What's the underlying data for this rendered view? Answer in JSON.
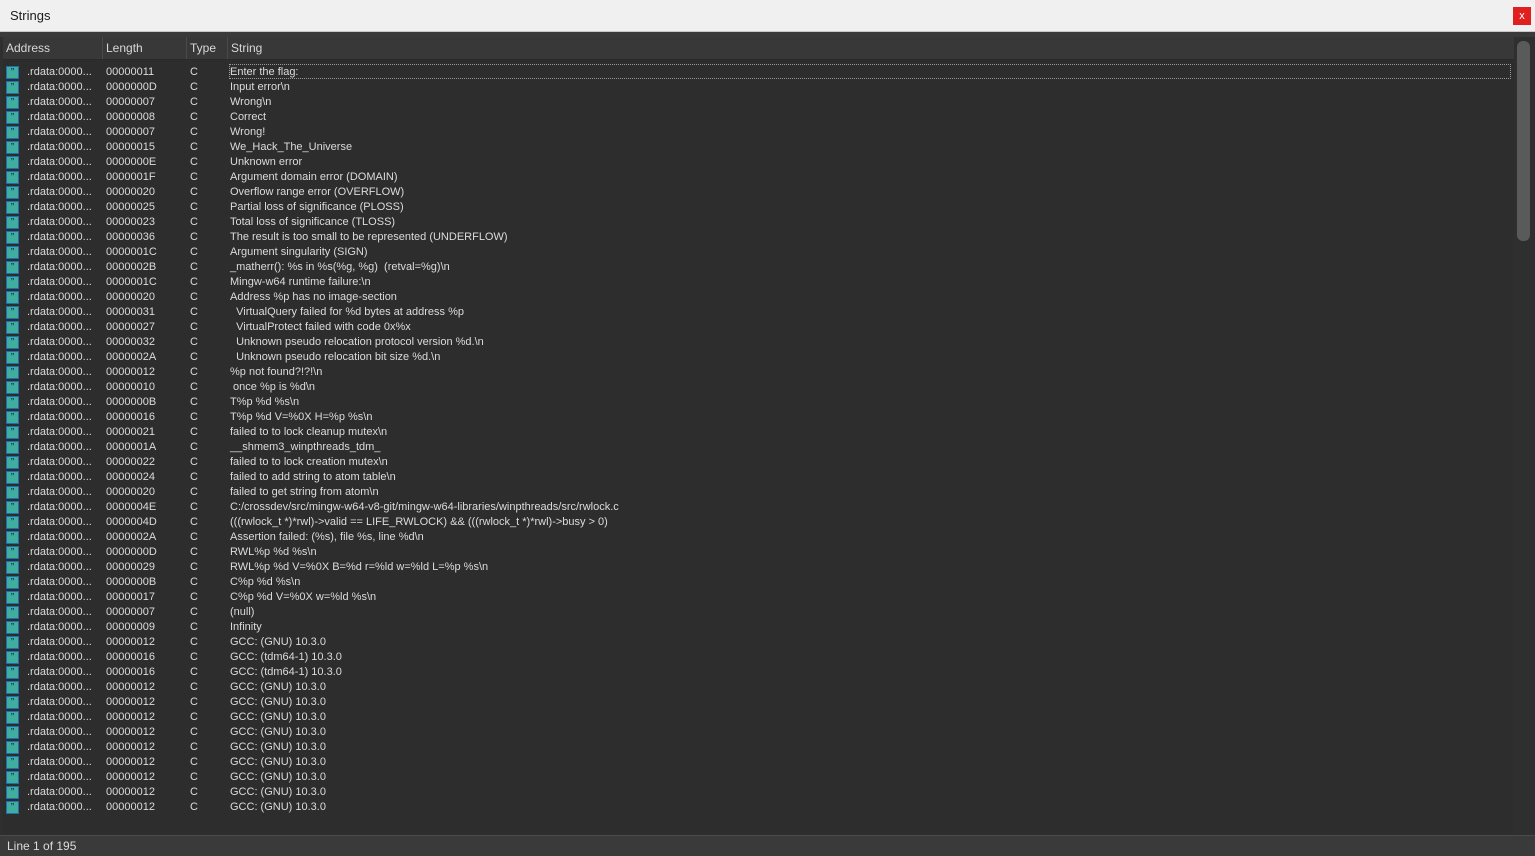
{
  "window": {
    "title": "Strings",
    "close_label": "x"
  },
  "columns": [
    "Address",
    "Length",
    "Type",
    "String"
  ],
  "rows": [
    {
      "address": ".rdata:0000...",
      "length": "00000011",
      "type": "C",
      "string": "Enter the flag:"
    },
    {
      "address": ".rdata:0000...",
      "length": "0000000D",
      "type": "C",
      "string": "Input error\\n"
    },
    {
      "address": ".rdata:0000...",
      "length": "00000007",
      "type": "C",
      "string": "Wrong\\n"
    },
    {
      "address": ".rdata:0000...",
      "length": "00000008",
      "type": "C",
      "string": "Correct"
    },
    {
      "address": ".rdata:0000...",
      "length": "00000007",
      "type": "C",
      "string": "Wrong!"
    },
    {
      "address": ".rdata:0000...",
      "length": "00000015",
      "type": "C",
      "string": "We_Hack_The_Universe"
    },
    {
      "address": ".rdata:0000...",
      "length": "0000000E",
      "type": "C",
      "string": "Unknown error"
    },
    {
      "address": ".rdata:0000...",
      "length": "0000001F",
      "type": "C",
      "string": "Argument domain error (DOMAIN)"
    },
    {
      "address": ".rdata:0000...",
      "length": "00000020",
      "type": "C",
      "string": "Overflow range error (OVERFLOW)"
    },
    {
      "address": ".rdata:0000...",
      "length": "00000025",
      "type": "C",
      "string": "Partial loss of significance (PLOSS)"
    },
    {
      "address": ".rdata:0000...",
      "length": "00000023",
      "type": "C",
      "string": "Total loss of significance (TLOSS)"
    },
    {
      "address": ".rdata:0000...",
      "length": "00000036",
      "type": "C",
      "string": "The result is too small to be represented (UNDERFLOW)"
    },
    {
      "address": ".rdata:0000...",
      "length": "0000001C",
      "type": "C",
      "string": "Argument singularity (SIGN)"
    },
    {
      "address": ".rdata:0000...",
      "length": "0000002B",
      "type": "C",
      "string": "_matherr(): %s in %s(%g, %g)  (retval=%g)\\n"
    },
    {
      "address": ".rdata:0000...",
      "length": "0000001C",
      "type": "C",
      "string": "Mingw-w64 runtime failure:\\n"
    },
    {
      "address": ".rdata:0000...",
      "length": "00000020",
      "type": "C",
      "string": "Address %p has no image-section"
    },
    {
      "address": ".rdata:0000...",
      "length": "00000031",
      "type": "C",
      "string": "  VirtualQuery failed for %d bytes at address %p"
    },
    {
      "address": ".rdata:0000...",
      "length": "00000027",
      "type": "C",
      "string": "  VirtualProtect failed with code 0x%x"
    },
    {
      "address": ".rdata:0000...",
      "length": "00000032",
      "type": "C",
      "string": "  Unknown pseudo relocation protocol version %d.\\n"
    },
    {
      "address": ".rdata:0000...",
      "length": "0000002A",
      "type": "C",
      "string": "  Unknown pseudo relocation bit size %d.\\n"
    },
    {
      "address": ".rdata:0000...",
      "length": "00000012",
      "type": "C",
      "string": "%p not found?!?!\\n"
    },
    {
      "address": ".rdata:0000...",
      "length": "00000010",
      "type": "C",
      "string": " once %p is %d\\n"
    },
    {
      "address": ".rdata:0000...",
      "length": "0000000B",
      "type": "C",
      "string": "T%p %d %s\\n"
    },
    {
      "address": ".rdata:0000...",
      "length": "00000016",
      "type": "C",
      "string": "T%p %d V=%0X H=%p %s\\n"
    },
    {
      "address": ".rdata:0000...",
      "length": "00000021",
      "type": "C",
      "string": "failed to to lock cleanup mutex\\n"
    },
    {
      "address": ".rdata:0000...",
      "length": "0000001A",
      "type": "C",
      "string": "__shmem3_winpthreads_tdm_"
    },
    {
      "address": ".rdata:0000...",
      "length": "00000022",
      "type": "C",
      "string": "failed to to lock creation mutex\\n"
    },
    {
      "address": ".rdata:0000...",
      "length": "00000024",
      "type": "C",
      "string": "failed to add string to atom table\\n"
    },
    {
      "address": ".rdata:0000...",
      "length": "00000020",
      "type": "C",
      "string": "failed to get string from atom\\n"
    },
    {
      "address": ".rdata:0000...",
      "length": "0000004E",
      "type": "C",
      "string": "C:/crossdev/src/mingw-w64-v8-git/mingw-w64-libraries/winpthreads/src/rwlock.c"
    },
    {
      "address": ".rdata:0000...",
      "length": "0000004D",
      "type": "C",
      "string": "(((rwlock_t *)*rwl)->valid == LIFE_RWLOCK) && (((rwlock_t *)*rwl)->busy > 0)"
    },
    {
      "address": ".rdata:0000...",
      "length": "0000002A",
      "type": "C",
      "string": "Assertion failed: (%s), file %s, line %d\\n"
    },
    {
      "address": ".rdata:0000...",
      "length": "0000000D",
      "type": "C",
      "string": "RWL%p %d %s\\n"
    },
    {
      "address": ".rdata:0000...",
      "length": "00000029",
      "type": "C",
      "string": "RWL%p %d V=%0X B=%d r=%ld w=%ld L=%p %s\\n"
    },
    {
      "address": ".rdata:0000...",
      "length": "0000000B",
      "type": "C",
      "string": "C%p %d %s\\n"
    },
    {
      "address": ".rdata:0000...",
      "length": "00000017",
      "type": "C",
      "string": "C%p %d V=%0X w=%ld %s\\n"
    },
    {
      "address": ".rdata:0000...",
      "length": "00000007",
      "type": "C",
      "string": "(null)"
    },
    {
      "address": ".rdata:0000...",
      "length": "00000009",
      "type": "C",
      "string": "Infinity"
    },
    {
      "address": ".rdata:0000...",
      "length": "00000012",
      "type": "C",
      "string": "GCC: (GNU) 10.3.0"
    },
    {
      "address": ".rdata:0000...",
      "length": "00000016",
      "type": "C",
      "string": "GCC: (tdm64-1) 10.3.0"
    },
    {
      "address": ".rdata:0000...",
      "length": "00000016",
      "type": "C",
      "string": "GCC: (tdm64-1) 10.3.0"
    },
    {
      "address": ".rdata:0000...",
      "length": "00000012",
      "type": "C",
      "string": "GCC: (GNU) 10.3.0"
    },
    {
      "address": ".rdata:0000...",
      "length": "00000012",
      "type": "C",
      "string": "GCC: (GNU) 10.3.0"
    },
    {
      "address": ".rdata:0000...",
      "length": "00000012",
      "type": "C",
      "string": "GCC: (GNU) 10.3.0"
    },
    {
      "address": ".rdata:0000...",
      "length": "00000012",
      "type": "C",
      "string": "GCC: (GNU) 10.3.0"
    },
    {
      "address": ".rdata:0000...",
      "length": "00000012",
      "type": "C",
      "string": "GCC: (GNU) 10.3.0"
    },
    {
      "address": ".rdata:0000...",
      "length": "00000012",
      "type": "C",
      "string": "GCC: (GNU) 10.3.0"
    },
    {
      "address": ".rdata:0000...",
      "length": "00000012",
      "type": "C",
      "string": "GCC: (GNU) 10.3.0"
    },
    {
      "address": ".rdata:0000...",
      "length": "00000012",
      "type": "C",
      "string": "GCC: (GNU) 10.3.0"
    },
    {
      "address": ".rdata:0000...",
      "length": "00000012",
      "type": "C",
      "string": "GCC: (GNU) 10.3.0"
    }
  ],
  "status": {
    "text": "Line 1 of 195"
  },
  "colors": {
    "icon_fill": "#3fae9e",
    "icon_border": "#1f6fb0",
    "close_button": "#e02020"
  },
  "icons": {
    "row_icon": "string-icon"
  }
}
